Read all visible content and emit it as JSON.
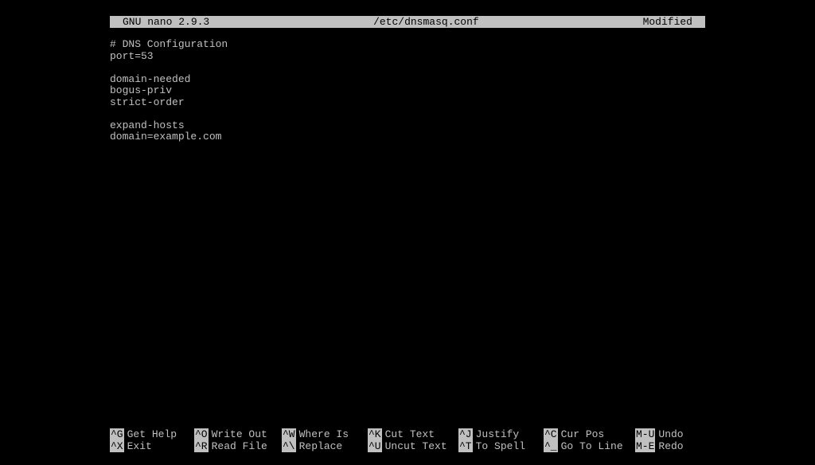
{
  "title_bar": {
    "left": "GNU nano 2.9.3",
    "center": "/etc/dnsmasq.conf",
    "right": "Modified"
  },
  "file_content": [
    "# DNS Configuration",
    "port=53",
    "",
    "domain-needed",
    "bogus-priv",
    "strict-order",
    "",
    "expand-hosts",
    "domain=example.com"
  ],
  "shortcuts": {
    "row1": [
      {
        "key": "^G",
        "label": "Get Help"
      },
      {
        "key": "^O",
        "label": "Write Out"
      },
      {
        "key": "^W",
        "label": "Where Is"
      },
      {
        "key": "^K",
        "label": "Cut Text"
      },
      {
        "key": "^J",
        "label": "Justify"
      },
      {
        "key": "^C",
        "label": "Cur Pos"
      },
      {
        "key": "M-U",
        "label": "Undo"
      }
    ],
    "row2": [
      {
        "key": "^X",
        "label": "Exit"
      },
      {
        "key": "^R",
        "label": "Read File"
      },
      {
        "key": "^\\",
        "label": "Replace"
      },
      {
        "key": "^U",
        "label": "Uncut Text"
      },
      {
        "key": "^T",
        "label": "To Spell"
      },
      {
        "key": "^_",
        "label": "Go To Line"
      },
      {
        "key": "M-E",
        "label": "Redo"
      }
    ]
  }
}
